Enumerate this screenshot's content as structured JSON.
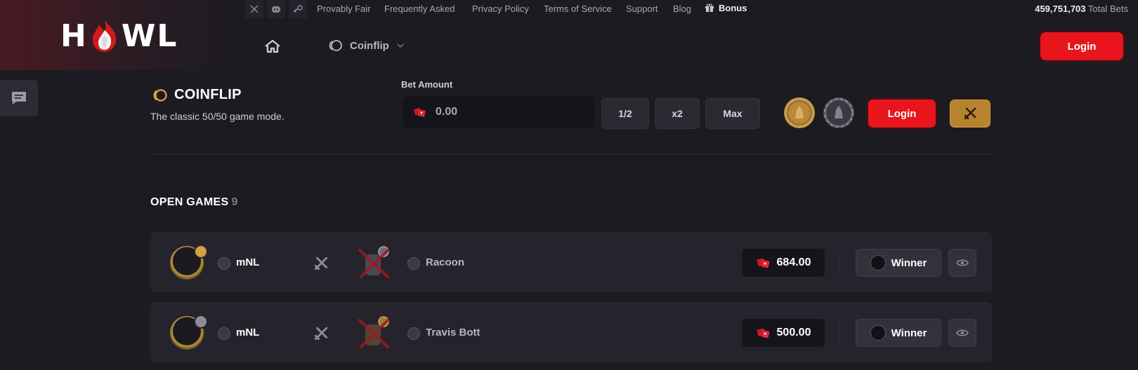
{
  "topnav": {
    "social": [
      "x-icon",
      "discord-icon",
      "steam-icon"
    ],
    "links": [
      "Provably Fair",
      "Frequently Asked",
      "Privacy Policy",
      "Terms of Service",
      "Support",
      "Blog"
    ],
    "bonus": "Bonus",
    "total_bets_value": "459,751,703",
    "total_bets_label": "Total Bets"
  },
  "header": {
    "logo_left": "H",
    "logo_right": "WL",
    "game_selector": "Coinflip",
    "login_label": "Login"
  },
  "game": {
    "title": "COINFLIP",
    "subtitle": "The classic 50/50 game mode.",
    "bet_label": "Bet Amount",
    "bet_value": "0.00",
    "half_label": "1/2",
    "double_label": "x2",
    "max_label": "Max",
    "login_label": "Login"
  },
  "open_games": {
    "label": "OPEN GAMES",
    "count": "9",
    "rows": [
      {
        "player": "mNL",
        "opponent": "Racoon",
        "amount": "684.00",
        "action": "Winner"
      },
      {
        "player": "mNL",
        "opponent": "Travis Bott",
        "amount": "500.00",
        "action": "Winner"
      }
    ]
  },
  "colors": {
    "accent_red": "#e8151c",
    "gold": "#b8832f",
    "bg": "#1c1b22"
  }
}
